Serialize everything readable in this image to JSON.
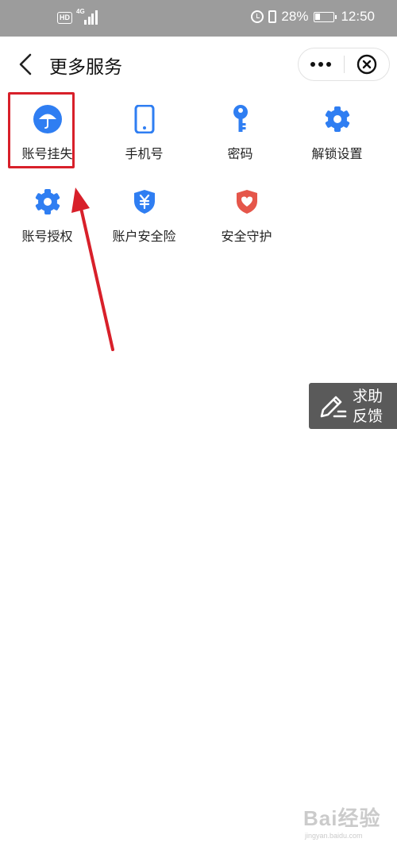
{
  "status_bar": {
    "hd": "HD",
    "network": "4G",
    "battery": "28%",
    "time": "12:50"
  },
  "nav": {
    "title": "更多服务",
    "back_icon": "chevron-left-icon",
    "more_icon": "more-dots-icon",
    "close_icon": "close-circle-icon"
  },
  "services": [
    {
      "label": "账号挂失",
      "icon": "umbrella-icon",
      "color": "#2f7ef2",
      "highlighted": true
    },
    {
      "label": "手机号",
      "icon": "phone-icon",
      "color": "#2f7ef2"
    },
    {
      "label": "密码",
      "icon": "key-icon",
      "color": "#2f7ef2"
    },
    {
      "label": "解锁设置",
      "icon": "gear-icon",
      "color": "#2f7ef2"
    },
    {
      "label": "账号授权",
      "icon": "gear-icon",
      "color": "#2f7ef2"
    },
    {
      "label": "账户安全险",
      "icon": "yuan-shield-icon",
      "color": "#2f7ef2"
    },
    {
      "label": "安全守护",
      "icon": "heart-shield-icon",
      "color": "#e5564a"
    }
  ],
  "help_float": {
    "line1": "求助",
    "line2": "反馈",
    "icon": "edit-icon"
  },
  "annotation": {
    "color": "#d8202a"
  },
  "watermark": {
    "main": "Bai经验",
    "sub": "jingyan.baidu.com"
  }
}
